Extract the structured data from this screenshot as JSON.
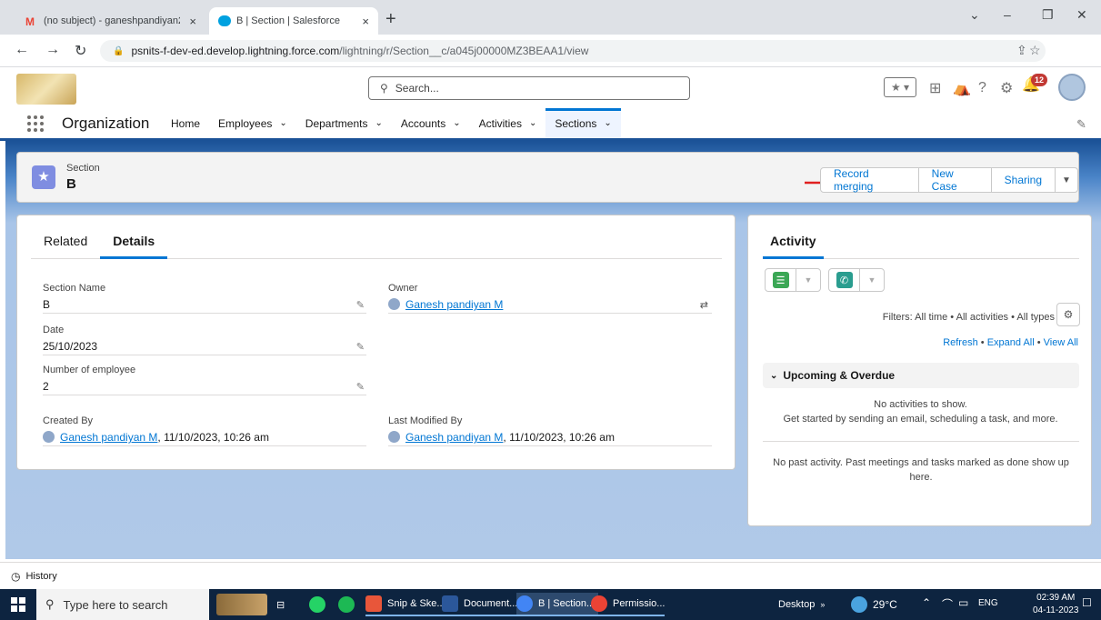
{
  "browser": {
    "tabs": [
      {
        "label": "(no subject) - ganeshpandiyan2",
        "active": false
      },
      {
        "label": "B | Section | Salesforce",
        "active": true
      }
    ],
    "url_main": "psnits-f-dev-ed.develop.lightning.force.com",
    "url_path": "/lightning/r/Section__c/a045j00000MZ3BEAA1/view"
  },
  "header": {
    "search_placeholder": "Search...",
    "notification_count": "12"
  },
  "nav": {
    "app_name": "Organization",
    "items": [
      {
        "label": "Home",
        "dropdown": false
      },
      {
        "label": "Employees",
        "dropdown": true
      },
      {
        "label": "Departments",
        "dropdown": true
      },
      {
        "label": "Accounts",
        "dropdown": true
      },
      {
        "label": "Activities",
        "dropdown": true
      },
      {
        "label": "Sections",
        "dropdown": true,
        "active": true
      }
    ]
  },
  "record": {
    "object_type": "Section",
    "name": "B",
    "actions": [
      "Record merging",
      "New Case",
      "Sharing"
    ]
  },
  "details": {
    "tabs": [
      "Related",
      "Details"
    ],
    "active_tab": "Details",
    "fields": {
      "section_name": {
        "label": "Section Name",
        "value": "B"
      },
      "owner": {
        "label": "Owner",
        "value": "Ganesh pandiyan M"
      },
      "date": {
        "label": "Date",
        "value": "25/10/2023"
      },
      "num_employee": {
        "label": "Number of employee",
        "value": "2"
      },
      "created_by": {
        "label": "Created By",
        "user": "Ganesh pandiyan M",
        "timestamp": ", 11/10/2023, 10:26 am"
      },
      "last_modified_by": {
        "label": "Last Modified By",
        "user": "Ganesh pandiyan M",
        "timestamp": ", 11/10/2023, 10:26 am"
      }
    }
  },
  "activity": {
    "title": "Activity",
    "filters": "Filters: All time • All activities • All types",
    "links": {
      "refresh": "Refresh",
      "expand": "Expand All",
      "view": "View All"
    },
    "upcoming_label": "Upcoming & Overdue",
    "no_activities": "No activities to show.",
    "get_started": "Get started by sending an email, scheduling a task, and more.",
    "past_note": "No past activity. Past meetings and tasks marked as done show up here."
  },
  "footer": {
    "history_label": "History"
  },
  "taskbar": {
    "search_placeholder": "Type here to search",
    "apps": [
      "Snip & Ske...",
      "Document...",
      "B | Section...",
      "Permissio..."
    ],
    "desktop_label": "Desktop",
    "weather": "29°C",
    "lang": "ENG",
    "time": "02:39 AM",
    "date": "04-11-2023"
  },
  "colors": {
    "brand_blue": "#0176d3",
    "header_band": "#1b5297",
    "section_icon": "#7f8de1",
    "arrow_red": "#e02020"
  }
}
